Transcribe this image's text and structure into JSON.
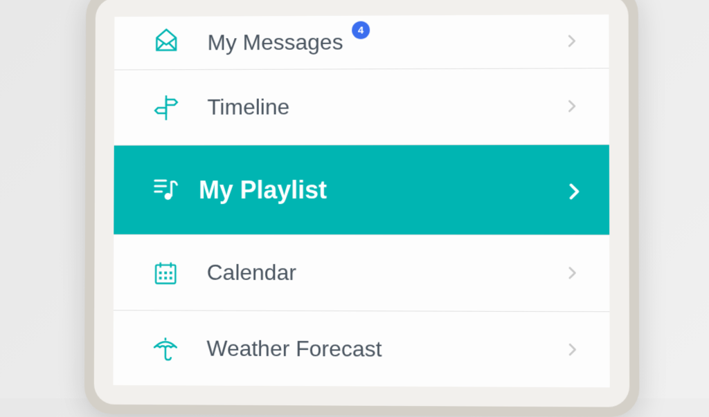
{
  "colors": {
    "accent": "#00b5b2",
    "text": "#4a5560",
    "muted_chevron": "#c8c8c8",
    "badge_bg": "#3b6eef",
    "badge_text": "#ffffff"
  },
  "menu": {
    "items": [
      {
        "label": "My Messages",
        "badge": "4",
        "icon": "envelope",
        "active": false
      },
      {
        "label": "Timeline",
        "icon": "signpost",
        "active": false
      },
      {
        "label": "My Playlist",
        "icon": "music-list",
        "active": true
      },
      {
        "label": "Calendar",
        "icon": "calendar",
        "active": false
      },
      {
        "label": "Weather Forecast",
        "icon": "umbrella",
        "active": false
      }
    ]
  }
}
